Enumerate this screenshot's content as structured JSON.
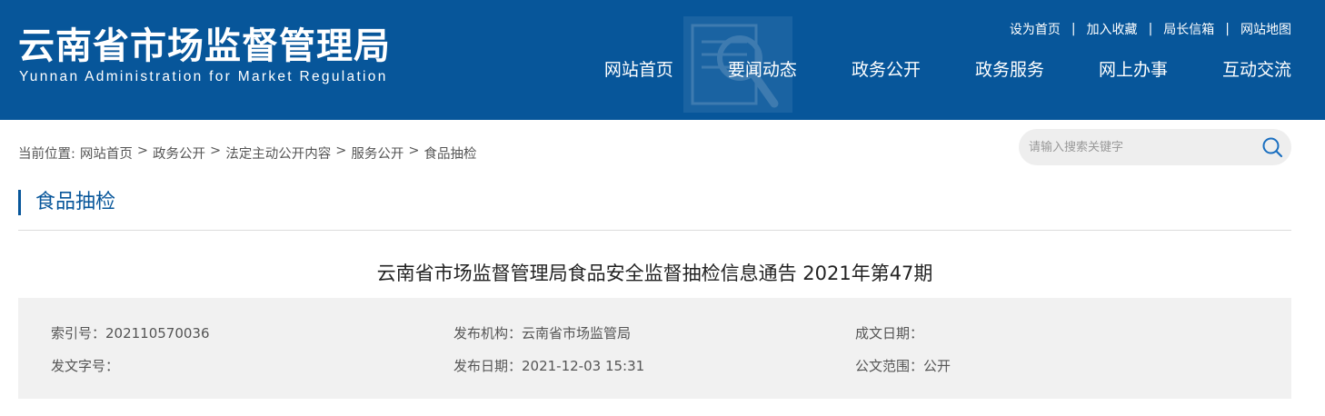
{
  "header": {
    "title_cn": "云南省市场监督管理局",
    "title_en": "Yunnan Administration for Market Regulation",
    "bg_color": "#07569a"
  },
  "toplinks": [
    "设为首页",
    "加入收藏",
    "局长信箱",
    "网站地图"
  ],
  "toplinks_separator": "|",
  "mainnav": [
    "网站首页",
    "要闻动态",
    "政务公开",
    "政务服务",
    "网上办事",
    "互动交流"
  ],
  "breadcrumb": {
    "prefix": "当前位置:",
    "items": [
      "网站首页",
      "政务公开",
      "法定主动公开内容",
      "服务公开",
      "食品抽检"
    ],
    "separator": ">"
  },
  "search": {
    "placeholder": "请输入搜索关键字",
    "icon": "search-icon"
  },
  "section": {
    "title": "食品抽检"
  },
  "article": {
    "title": "云南省市场监督管理局食品安全监督抽检信息通告 2021年第47期"
  },
  "meta": {
    "index_no": "索引号：202110570036",
    "publisher": "发布机构：云南省市场监管局",
    "written_date": "成文日期：",
    "doc_no": "发文字号：",
    "publish_date": "发布日期：2021-12-03 15:31",
    "scope": "公文范围：公开"
  }
}
